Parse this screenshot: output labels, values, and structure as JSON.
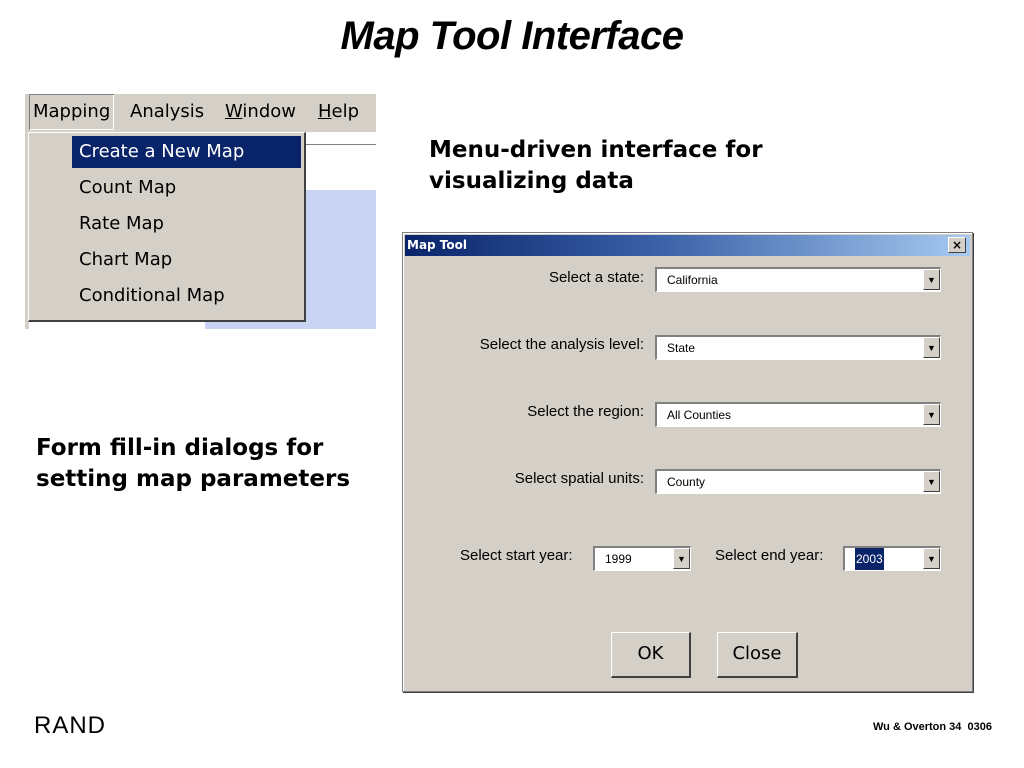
{
  "slide": {
    "title": "Map Tool Interface",
    "caption_menu": "Menu-driven interface for visualizing data",
    "caption_form": "Form fill-in dialogs for setting map parameters",
    "logo_text": "RAND",
    "footer": "Wu & Overton 34  0306"
  },
  "menu": {
    "bar": [
      {
        "label": "Mapping"
      },
      {
        "label": "Analysis"
      },
      {
        "label_pre": "",
        "label_u": "W",
        "label_post": "indow"
      },
      {
        "label_pre": "",
        "label_u": "H",
        "label_post": "elp"
      }
    ],
    "items": [
      "Create a New Map",
      "Count Map",
      "Rate Map",
      "Chart Map",
      "Conditional Map"
    ],
    "selected_index": 0
  },
  "dialog": {
    "title": "Map Tool",
    "close_glyph": "×",
    "fields": {
      "state": {
        "label": "Select a state:",
        "value": "California"
      },
      "analysis_level": {
        "label": "Select the analysis level:",
        "value": "State"
      },
      "region": {
        "label": "Select the region:",
        "value": "All Counties"
      },
      "spatial_units": {
        "label": "Select spatial units:",
        "value": "County"
      },
      "start_year": {
        "label": "Select start year:",
        "value": "1999"
      },
      "end_year": {
        "label": "Select end year:",
        "value": "2003"
      }
    },
    "arrow_glyph": "▼",
    "ok_label": "OK",
    "close_label": "Close"
  },
  "colors": {
    "dialog_face": "#d4d0c8",
    "selection": "#0a246a",
    "titlebar_start": "#0a246a",
    "titlebar_end": "#a6caf0"
  },
  "icons": [
    "close-icon",
    "dropdown-arrow-icon"
  ]
}
